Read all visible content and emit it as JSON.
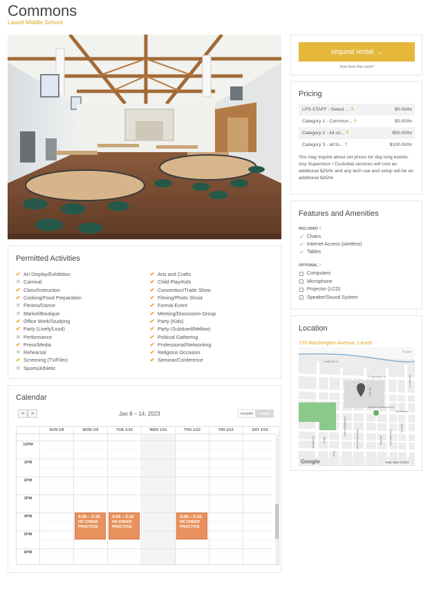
{
  "header": {
    "title": "Commons",
    "subtitle": "Laurel Middle School"
  },
  "permitted": {
    "title": "Permitted Activities",
    "left": [
      {
        "label": "Art Display/Exhibition",
        "allowed": true
      },
      {
        "label": "Carnival",
        "allowed": false
      },
      {
        "label": "Class/Instruction",
        "allowed": true
      },
      {
        "label": "Cooking/Food Preparation",
        "allowed": true
      },
      {
        "label": "Fitness/Dance",
        "allowed": false
      },
      {
        "label": "Market/Boutique",
        "allowed": false
      },
      {
        "label": "Office Work/Studying",
        "allowed": true
      },
      {
        "label": "Party (Lively/Loud)",
        "allowed": true
      },
      {
        "label": "Performance",
        "allowed": false
      },
      {
        "label": "Press/Media",
        "allowed": true
      },
      {
        "label": "Rehearsal",
        "allowed": false
      },
      {
        "label": "Screening (TV/Film)",
        "allowed": true
      },
      {
        "label": "Sports/Athletic",
        "allowed": false
      }
    ],
    "right": [
      {
        "label": "Arts and Crafts",
        "allowed": true
      },
      {
        "label": "Child Play/Kids",
        "allowed": true
      },
      {
        "label": "Convention/Trade Show",
        "allowed": true
      },
      {
        "label": "Filming/Photo Shoot",
        "allowed": true
      },
      {
        "label": "Formal Event",
        "allowed": true
      },
      {
        "label": "Meeting/Discussion Group",
        "allowed": true
      },
      {
        "label": "Party (Kids)",
        "allowed": true
      },
      {
        "label": "Party (Subdued/Mellow)",
        "allowed": true
      },
      {
        "label": "Political Gathering",
        "allowed": true
      },
      {
        "label": "Professional/Networking",
        "allowed": true
      },
      {
        "label": "Religious Occasion",
        "allowed": true
      },
      {
        "label": "Seminar/Conference",
        "allowed": true
      }
    ]
  },
  "calendar": {
    "title": "Calendar",
    "prev": "<",
    "next": ">",
    "range": "Jan 8 – 14, 2023",
    "view_month": "month",
    "view_week": "week",
    "days": [
      "SUN 1/8",
      "MON 1/9",
      "TUE 1/10",
      "WED 1/11",
      "THU 1/12",
      "FRI 1/13",
      "SAT 1/14"
    ],
    "hours": [
      "12PM",
      "1PM",
      "2PM",
      "3PM",
      "4PM",
      "5PM",
      "6PM"
    ],
    "events": [
      {
        "day": 1,
        "time": "4:00 – 5:30",
        "title": "HS CHEER PRACTICE"
      },
      {
        "day": 2,
        "time": "4:00 – 5:30",
        "title": "HS CHEER PRACTICE"
      },
      {
        "day": 4,
        "time": "4:00 – 5:30",
        "title": "HS CHEER PRACTICE"
      }
    ]
  },
  "request": {
    "button": "request rental",
    "link": "how does this work?"
  },
  "pricing": {
    "title": "Pricing",
    "rows": [
      {
        "label": "LPS STAFF - Select ...",
        "price": "$0.00/hr"
      },
      {
        "label": "Category 1 - Commun...",
        "price": "$0.00/hr"
      },
      {
        "label": "Category 2 - All co...",
        "price": "$50.00/hr"
      },
      {
        "label": "Category 3 - all fo...",
        "price": "$100.00/hr"
      }
    ],
    "note": "You may inquire about set prices for day long events. Any Supervisor / Custodial services will cost an additional $25/hr and any tech use and setup will be an additional $35/hr"
  },
  "features": {
    "title": "Features and Amenities",
    "included_label": "INCLUDED",
    "included": [
      "Chairs",
      "Internet Access (wireless)",
      "Tables"
    ],
    "optional_label": "OPTIONAL",
    "optional": [
      "Computers",
      "Microphone",
      "Projector (LCD)",
      "Speaker/Sound System"
    ]
  },
  "location": {
    "title": "Location",
    "address": "725 Washington Avenue, Laurel",
    "streets": [
      "Smith Pa Dr",
      "E Maryland Ln",
      "Eleanor Roosevelt Dr",
      "8th Ave",
      "Sycamore",
      "Colorado Ave",
      "Washington Ave",
      "Yellowstone Ave",
      "5th Ave",
      "Main St",
      "Woodland",
      "Birch",
      "Spruce Ln",
      "Plum",
      "Fir Ave"
    ],
    "google": "Google",
    "map_credit": "Map data ©2023"
  },
  "colors": {
    "accent": "#e0a21c",
    "button": "#e5b73b",
    "event": "#e8915d"
  }
}
